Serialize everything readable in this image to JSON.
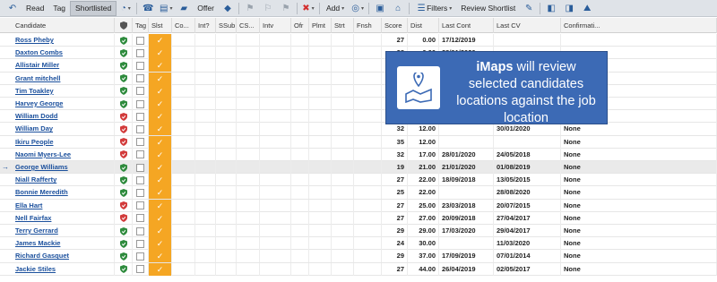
{
  "toolbar": {
    "read": "Read",
    "tag": "Tag",
    "shortlisted": "Shortlisted",
    "offer": "Offer",
    "add": "Add",
    "filters": "Filters",
    "review_shortlist": "Review Shortlist"
  },
  "columns": [
    "Candidate",
    "",
    "Tag",
    "Slst",
    "Co...",
    "Int?",
    "SSub",
    "CS...",
    "Intv",
    "Ofr",
    "Plmt",
    "Strt",
    "Fnsh",
    "Score",
    "Dist",
    "Last Cont",
    "Last CV",
    "Confirmati..."
  ],
  "rows": [
    {
      "name": "Ross Pheby",
      "shield": "green",
      "score": "27",
      "dist": "0.00",
      "last_cont": "17/12/2019",
      "last_cv": "",
      "conf": ""
    },
    {
      "name": "Daxton Combs",
      "shield": "green",
      "score": "28",
      "dist": "0.00",
      "last_cont": "28/01/2020",
      "last_cv": "",
      "conf": ""
    },
    {
      "name": "Allistair Miller",
      "shield": "green",
      "score": "",
      "dist": "",
      "last_cont": "",
      "last_cv": "",
      "conf": ""
    },
    {
      "name": "Grant mitchell",
      "shield": "green",
      "score": "",
      "dist": "",
      "last_cont": "",
      "last_cv": "",
      "conf": ""
    },
    {
      "name": "Tim Toakley",
      "shield": "green",
      "score": "",
      "dist": "",
      "last_cont": "",
      "last_cv": "",
      "conf": ""
    },
    {
      "name": "Harvey George",
      "shield": "green",
      "score": "",
      "dist": "",
      "last_cont": "",
      "last_cv": "",
      "conf": ""
    },
    {
      "name": "William Dodd",
      "shield": "red",
      "score": "",
      "dist": "",
      "last_cont": "",
      "last_cv": "",
      "conf": ""
    },
    {
      "name": "William Day",
      "shield": "red",
      "score": "32",
      "dist": "12.00",
      "last_cont": "",
      "last_cv": "30/01/2020",
      "conf": "None"
    },
    {
      "name": "Ikiru People",
      "shield": "red",
      "score": "35",
      "dist": "12.00",
      "last_cont": "",
      "last_cv": "",
      "conf": "None"
    },
    {
      "name": "Naomi Myers-Lee",
      "shield": "red",
      "score": "32",
      "dist": "17.00",
      "last_cont": "28/01/2020",
      "last_cv": "24/05/2018",
      "conf": "None"
    },
    {
      "name": "George Williams",
      "shield": "green",
      "score": "19",
      "dist": "21.00",
      "last_cont": "21/01/2020",
      "last_cv": "01/08/2019",
      "conf": "None"
    },
    {
      "name": "Niall Rafferty",
      "shield": "green",
      "score": "27",
      "dist": "22.00",
      "last_cont": "18/09/2018",
      "last_cv": "13/05/2015",
      "conf": "None"
    },
    {
      "name": "Bonnie Meredith",
      "shield": "green",
      "score": "25",
      "dist": "22.00",
      "last_cont": "",
      "last_cv": "28/08/2020",
      "conf": "None"
    },
    {
      "name": "Ella Hart",
      "shield": "red",
      "score": "27",
      "dist": "25.00",
      "last_cont": "23/03/2018",
      "last_cv": "20/07/2015",
      "conf": "None"
    },
    {
      "name": "Nell Fairfax",
      "shield": "red",
      "score": "27",
      "dist": "27.00",
      "last_cont": "20/09/2018",
      "last_cv": "27/04/2017",
      "conf": "None"
    },
    {
      "name": "Terry Gerrard",
      "shield": "green",
      "score": "29",
      "dist": "29.00",
      "last_cont": "17/03/2020",
      "last_cv": "29/04/2017",
      "conf": "None"
    },
    {
      "name": "James Mackie",
      "shield": "green",
      "score": "24",
      "dist": "30.00",
      "last_cont": "",
      "last_cv": "11/03/2020",
      "conf": "None"
    },
    {
      "name": "Richard Gasquet",
      "shield": "green",
      "score": "29",
      "dist": "37.00",
      "last_cont": "17/09/2019",
      "last_cv": "07/01/2014",
      "conf": "None"
    },
    {
      "name": "Jackie Stiles",
      "shield": "green",
      "score": "27",
      "dist": "44.00",
      "last_cont": "26/04/2019",
      "last_cv": "02/05/2017",
      "conf": "None"
    }
  ],
  "selected_row": 10,
  "callout": {
    "brand": "iMaps",
    "text": " will review selected candidates locations against the job location"
  },
  "colors": {
    "accent": "#3c6ab5",
    "shortlist": "#f5a623",
    "shield_green": "#2e8b3d",
    "shield_red": "#d23b3b"
  }
}
